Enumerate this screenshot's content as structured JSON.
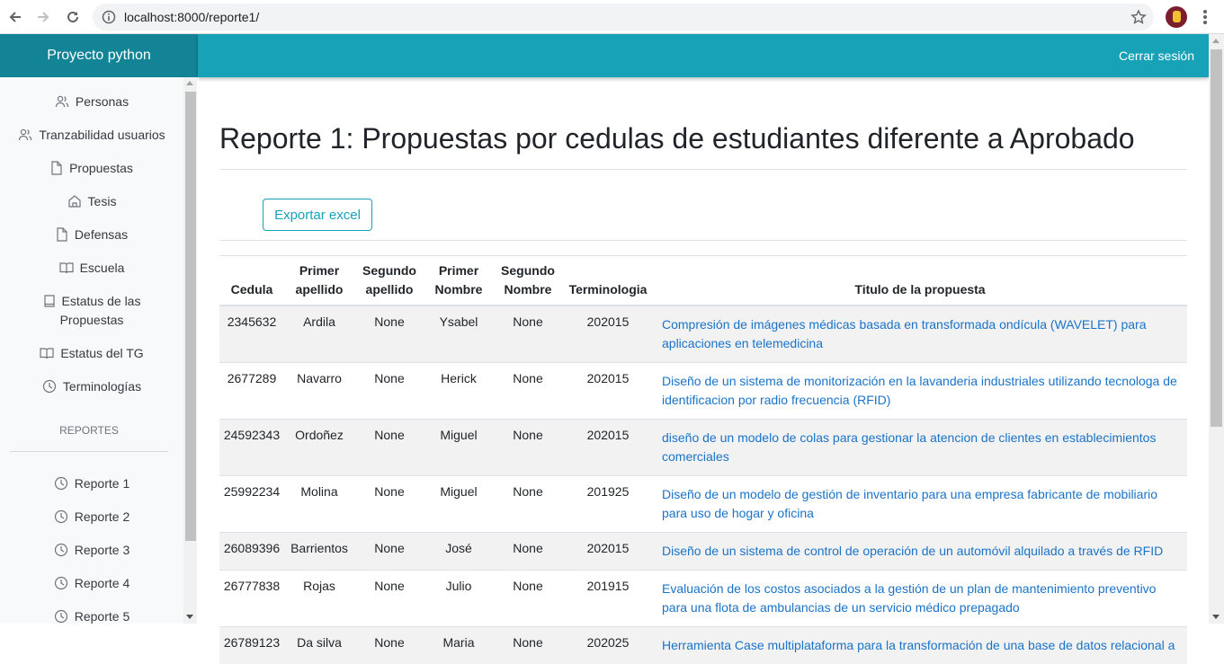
{
  "browser": {
    "url": "localhost:8000/reporte1/"
  },
  "header": {
    "brand": "Proyecto python",
    "logout": "Cerrar sesión"
  },
  "sidebar": {
    "items": [
      {
        "label": "Personas",
        "icon": "users-icon"
      },
      {
        "label": "Tranzabilidad usuarios",
        "icon": "users-icon"
      },
      {
        "label": "Propuestas",
        "icon": "file-icon"
      },
      {
        "label": "Tesis",
        "icon": "home-icon"
      },
      {
        "label": "Defensas",
        "icon": "file-icon"
      },
      {
        "label": "Escuela",
        "icon": "book-open-icon"
      },
      {
        "label_line1": "Estatus de las",
        "label_line2": "Propuestas",
        "icon": "book-icon"
      },
      {
        "label": "Estatus del TG",
        "icon": "book-open-icon"
      },
      {
        "label": "Terminologías",
        "icon": "clock-icon"
      }
    ],
    "section_heading": "REPORTES",
    "reports": [
      {
        "label": "Reporte 1",
        "icon": "clock-icon"
      },
      {
        "label": "Reporte 2",
        "icon": "clock-icon"
      },
      {
        "label": "Reporte 3",
        "icon": "clock-icon"
      },
      {
        "label": "Reporte 4",
        "icon": "clock-icon"
      },
      {
        "label": "Reporte 5",
        "icon": "clock-icon"
      }
    ]
  },
  "main": {
    "title": "Reporte 1: Propuestas por cedulas de estudiantes diferente a Aprobado",
    "export_button": "Exportar excel",
    "table": {
      "headers": [
        {
          "l1": "",
          "l2": "Cedula"
        },
        {
          "l1": "Primer",
          "l2": "apellido"
        },
        {
          "l1": "Segundo",
          "l2": "apellido"
        },
        {
          "l1": "Primer",
          "l2": "Nombre"
        },
        {
          "l1": "Segundo",
          "l2": "Nombre"
        },
        {
          "l1": "",
          "l2": "Terminologia"
        },
        {
          "l1": "",
          "l2": "Titulo de la propuesta"
        }
      ],
      "rows": [
        [
          "2345632",
          "Ardila",
          "None",
          "Ysabel",
          "None",
          "202015",
          "Compresión de imágenes médicas basada en transformada ondícula (WAVELET) para aplicaciones en telemedicina"
        ],
        [
          "2677289",
          "Navarro",
          "None",
          "Herick",
          "None",
          "202015",
          "Diseño de un sistema de monitorización en la lavanderia industriales utilizando tecnologa de identificacion por radio frecuencia (RFID)"
        ],
        [
          "24592343",
          "Ordoñez",
          "None",
          "Miguel",
          "None",
          "202015",
          "diseño de un modelo de colas para gestionar la atencion de clientes en establecimientos comerciales"
        ],
        [
          "25992234",
          "Molina",
          "None",
          "Miguel",
          "None",
          "201925",
          "Diseño de un modelo de gestión de inventario para una empresa fabricante de mobiliario para uso de hogar y oficina"
        ],
        [
          "26089396",
          "Barrientos",
          "None",
          "José",
          "None",
          "202015",
          "Diseño de un sistema de control de operación de un automóvil alquilado a través de RFID"
        ],
        [
          "26777838",
          "Rojas",
          "None",
          "Julio",
          "None",
          "201915",
          "Evaluación de los costos asociados a la gestión de un plan de mantenimiento preventivo para una flota de ambulancias de un servicio médico prepagado"
        ],
        [
          "26789123",
          "Da silva",
          "None",
          "Maria",
          "None",
          "202025",
          "Herramienta Case multiplataforma para la transformación de una base de datos relacional a"
        ]
      ]
    }
  }
}
